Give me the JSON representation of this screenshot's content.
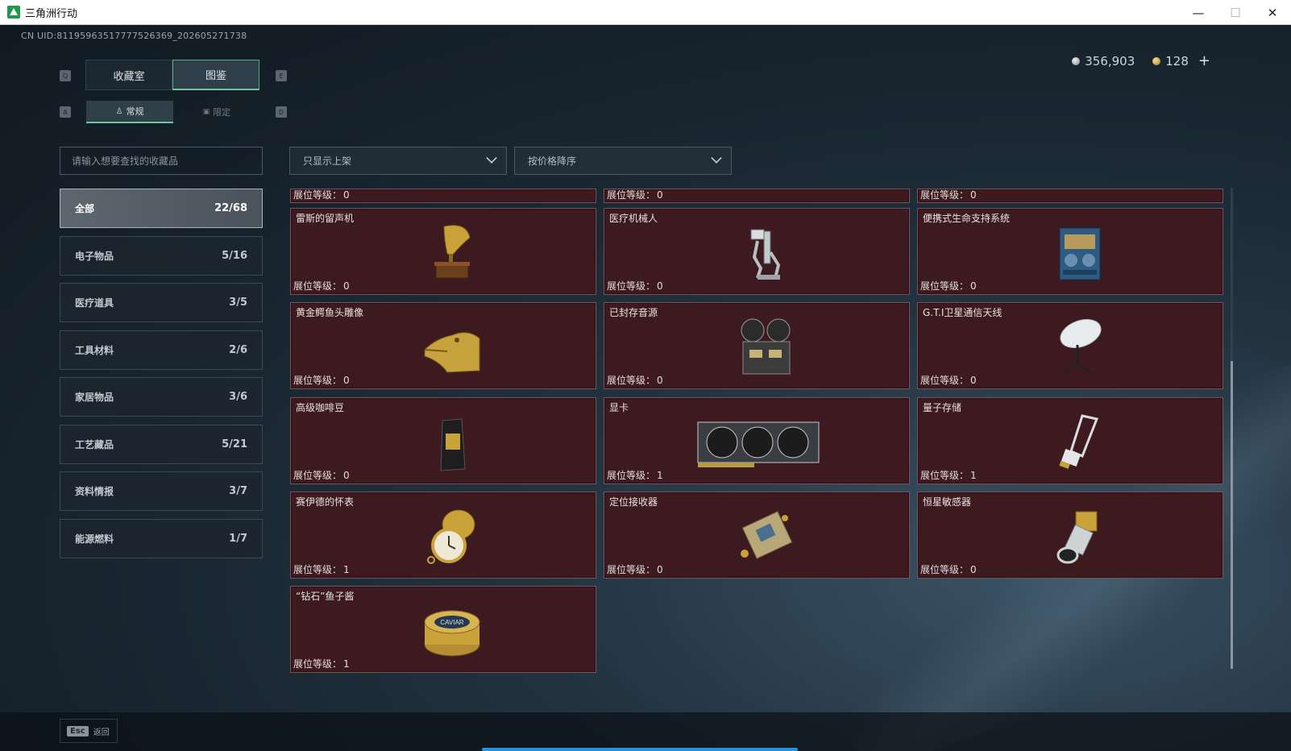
{
  "window": {
    "title": "三角洲行动",
    "minimize": "—",
    "maximize": "☐",
    "close": "✕"
  },
  "uid": "CN UID:81195963517777526369_202605271738",
  "currency": {
    "silver": "356,903",
    "gold": "128",
    "add": "+"
  },
  "key_hints": {
    "q": "Q",
    "e": "E",
    "a": "A",
    "d": "D"
  },
  "main_tabs": [
    {
      "label": "收藏室"
    },
    {
      "label": "图鉴"
    }
  ],
  "sub_tabs": [
    {
      "label": "常规"
    },
    {
      "label": "限定"
    }
  ],
  "search": {
    "placeholder": "请输入想要查找的收藏品"
  },
  "filters": {
    "shelf": "只显示上架",
    "sort": "按价格降序"
  },
  "categories": [
    {
      "label": "全部",
      "count": "22/68"
    },
    {
      "label": "电子物品",
      "count": "5/16"
    },
    {
      "label": "医疗道具",
      "count": "3/5"
    },
    {
      "label": "工具材料",
      "count": "2/6"
    },
    {
      "label": "家居物品",
      "count": "3/6"
    },
    {
      "label": "工艺藏品",
      "count": "5/21"
    },
    {
      "label": "资料情报",
      "count": "3/7"
    },
    {
      "label": "能源燃料",
      "count": "1/7"
    }
  ],
  "level_label": "展位等级：",
  "top_partial_levels": [
    "0",
    "0",
    "0"
  ],
  "items": [
    {
      "name": "雷斯的留声机",
      "level": "0",
      "icon": "gramophone-icon"
    },
    {
      "name": "医疗机械人",
      "level": "0",
      "icon": "medical-robot-icon"
    },
    {
      "name": "便携式生命支持系统",
      "level": "0",
      "icon": "life-support-icon"
    },
    {
      "name": "黄金鳄鱼头雕像",
      "level": "0",
      "icon": "golden-crocodile-icon"
    },
    {
      "name": "已封存音源",
      "level": "0",
      "icon": "tape-recorder-icon"
    },
    {
      "name": "G.T.I卫星通信天线",
      "level": "0",
      "icon": "satellite-dish-icon"
    },
    {
      "name": "高级咖啡豆",
      "level": "0",
      "icon": "coffee-bag-icon"
    },
    {
      "name": "显卡",
      "level": "1",
      "icon": "graphics-card-icon"
    },
    {
      "name": "量子存储",
      "level": "1",
      "icon": "quantum-storage-icon"
    },
    {
      "name": "赛伊德的怀表",
      "level": "1",
      "icon": "pocket-watch-icon"
    },
    {
      "name": "定位接收器",
      "level": "0",
      "icon": "gps-receiver-icon"
    },
    {
      "name": "恒星敏感器",
      "level": "0",
      "icon": "star-sensor-icon"
    },
    {
      "name": "“钻石”鱼子酱",
      "level": "1",
      "icon": "caviar-tin-icon"
    }
  ],
  "caviar_text": "CAVIAR",
  "footer": {
    "esc_key": "Esc",
    "back": "返回"
  }
}
